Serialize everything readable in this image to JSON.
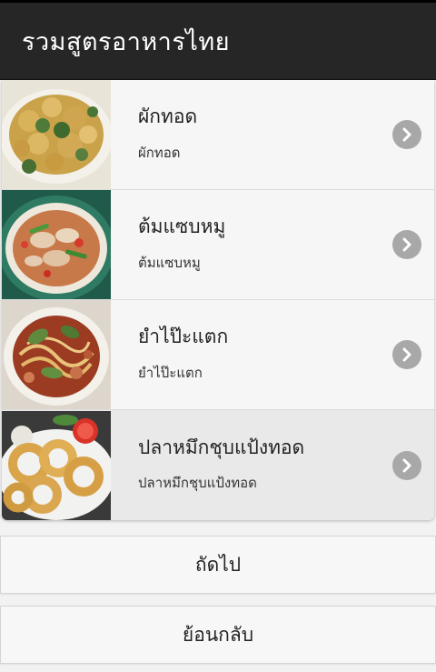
{
  "header": {
    "title": "รวมสูตรอาหารไทย"
  },
  "menu_items": [
    {
      "title": "ผักทอด",
      "subtitle": "ผักทอด",
      "image": "fried-vegetables-photo"
    },
    {
      "title": "ต้มแซบหมู",
      "subtitle": "ต้มแซบหมู",
      "image": "spicy-pork-soup-photo"
    },
    {
      "title": "ยำไป๊ะแตก",
      "subtitle": "ยำไป๊ะแตก",
      "image": "seafood-salad-photo"
    },
    {
      "title": "ปลาหมึกชุบแป้งทอด",
      "subtitle": "ปลาหมึกชุบแป้งทอด",
      "image": "fried-squid-photo"
    }
  ],
  "buttons": {
    "next": "ถัดไป",
    "back": "ย้อนกลับ"
  },
  "colors": {
    "header_bg": "#262626",
    "chevron_bg": "#a8a8a8",
    "list_bg": "#f6f6f6"
  }
}
